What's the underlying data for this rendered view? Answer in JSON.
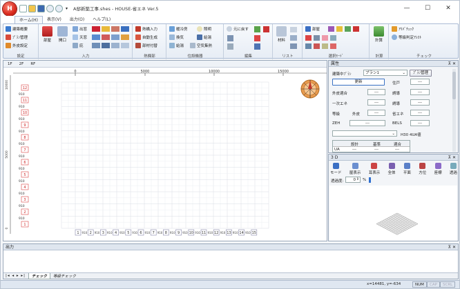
{
  "window": {
    "title": "A邸新築工事.shes - HOUSE-省エネ Ver.5",
    "app_letter": "H",
    "minimize": "—",
    "maximize": "☐",
    "close": "✕"
  },
  "ribbon_tabs": [
    "ホーム(H)",
    "表示(V)",
    "出力(O)",
    "ヘルプ(L)"
  ],
  "ribbon": {
    "settings": {
      "label": "設定",
      "items": [
        "建築概要",
        "ﾌﾟﾗﾝ管理",
        "外皮設定"
      ]
    },
    "input": {
      "label": "入力",
      "big": [
        "部屋",
        "開口"
      ],
      "items": [
        "出窓",
        "天窓",
        "庇"
      ]
    },
    "insulation": {
      "label": "熱欄部",
      "items": [
        "熱橋入力",
        "自動生成",
        "部材付替"
      ]
    },
    "equipment": {
      "label": "住設機器",
      "items": [
        "暖冷房",
        "照明",
        "換気",
        "給湯",
        "給湯",
        "空気集熱"
      ]
    },
    "edit": {
      "label": "編集",
      "items": [
        "元に戻す"
      ]
    },
    "list": {
      "label": "リスト",
      "big": [
        "材料"
      ]
    },
    "mode": {
      "label": "選択ﾓｰﾄﾞ",
      "items": [
        "部屋"
      ]
    },
    "calc": {
      "label": "計算",
      "big": [
        "計算"
      ]
    },
    "check": {
      "label": "チェック",
      "items": [
        "ｱﾘﾊﾞﾁｪｯｸ",
        "等級判定ｱｼｽﾄ"
      ]
    }
  },
  "floor_tabs": [
    "1F",
    "2F",
    "RF"
  ],
  "ruler": {
    "top": [
      "0",
      "5000",
      "10000",
      "15000"
    ],
    "left": [
      "10000",
      "5000",
      "0"
    ]
  },
  "row_labels": [
    "12",
    "11",
    "10",
    "9",
    "8",
    "7",
    "6",
    "5",
    "4",
    "3",
    "2",
    "1"
  ],
  "grid_sub_label": "910",
  "col_labels": [
    "1",
    "2",
    "3",
    "4",
    "5",
    "6",
    "7",
    "8",
    "9",
    "10",
    "11",
    "12",
    "13",
    "14",
    "15"
  ],
  "property": {
    "title": "属性",
    "plan_label": "建築中ﾌﾟﾗﾝ",
    "plan_value": "プラン1",
    "plan_manage": "ﾌﾟﾗﾝ管理",
    "update": "更新",
    "house_count_label": "住戸",
    "house_count_value": "---",
    "row1": {
      "a": "外皮適合",
      "b": "---",
      "c": "誘導",
      "d": "---"
    },
    "row2": {
      "a": "一次エネ",
      "b": "---",
      "c": "誘導",
      "d": "---"
    },
    "row3": {
      "a": "等級",
      "b": "外皮",
      "c": "---",
      "d": "省エネ",
      "e": "---"
    },
    "row4": {
      "a": "ZEH",
      "b": "---",
      "c": "BELS",
      "d": "---"
    },
    "h30": "H30 4UA値",
    "table_headers": [
      "設計",
      "基準",
      "適合"
    ],
    "table_row": {
      "label": "UA",
      "v1": "---",
      "v2": "---",
      "v3": "---"
    }
  },
  "view3d": {
    "title": "3 D",
    "tools": [
      "モード",
      "屋表示",
      "耳表示",
      "全体",
      "平面",
      "方位",
      "座標",
      "透過"
    ],
    "transparency_label": "透過度:",
    "transparency_value": "0",
    "percent": "%"
  },
  "output": {
    "title": "出力",
    "tabs": [
      "チェック",
      "等級チェック"
    ]
  },
  "status": {
    "coords": "x=14481, y=-634",
    "num": "NUM",
    "cap": "CAP",
    "scrl": "SCRL"
  }
}
